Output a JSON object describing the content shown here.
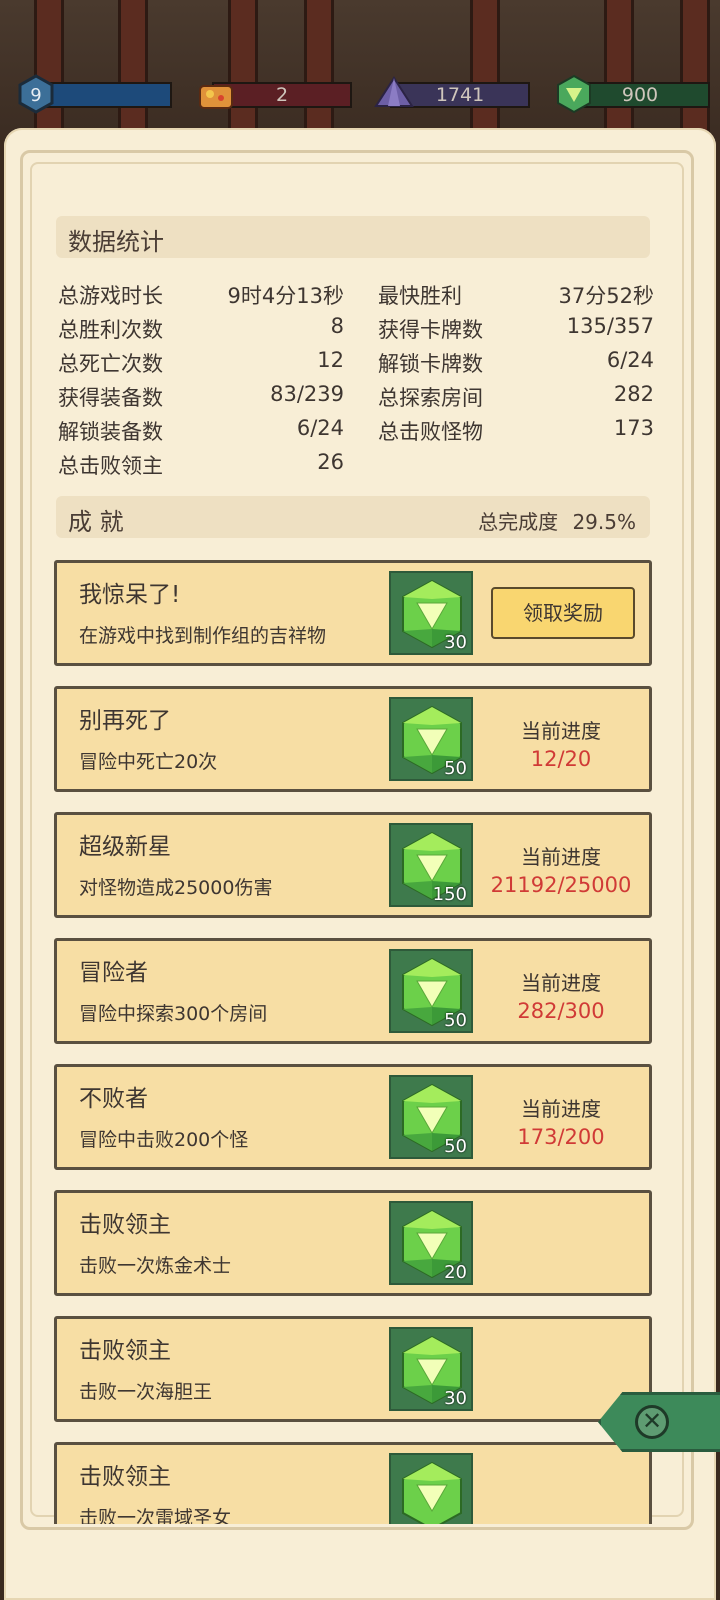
{
  "topbar": {
    "level": "9",
    "resources": [
      {
        "name": "chest",
        "value": "2",
        "color": "#5b1f24"
      },
      {
        "name": "crystal",
        "value": "1741",
        "color": "#3a3458"
      },
      {
        "name": "gem",
        "value": "900",
        "color": "#1f4a2e"
      }
    ]
  },
  "stats": {
    "title": "数据统计",
    "left": [
      {
        "label": "总游戏时长",
        "value": "9时4分13秒"
      },
      {
        "label": "总胜利次数",
        "value": "8"
      },
      {
        "label": "总死亡次数",
        "value": "12"
      },
      {
        "label": "获得装备数",
        "value": "83/239"
      },
      {
        "label": "解锁装备数",
        "value": "6/24"
      },
      {
        "label": "总击败领主",
        "value": "26"
      }
    ],
    "right": [
      {
        "label": "最快胜利",
        "value": "37分52秒"
      },
      {
        "label": "获得卡牌数",
        "value": "135/357"
      },
      {
        "label": "解锁卡牌数",
        "value": "6/24"
      },
      {
        "label": "总探索房间",
        "value": "282"
      },
      {
        "label": "总击败怪物",
        "value": "173"
      }
    ]
  },
  "achievements": {
    "title": "成 就",
    "completion_label": "总完成度",
    "completion_value": "29.5%",
    "progress_label": "当前进度",
    "claim_label": "领取奖励",
    "items": [
      {
        "title": "我惊呆了!",
        "desc": "在游戏中找到制作组的吉祥物",
        "reward": "30",
        "progress": "",
        "claimable": true
      },
      {
        "title": "别再死了",
        "desc": "冒险中死亡20次",
        "reward": "50",
        "progress": "12/20"
      },
      {
        "title": "超级新星",
        "desc": "对怪物造成25000伤害",
        "reward": "150",
        "progress": "21192/25000"
      },
      {
        "title": "冒险者",
        "desc": "冒险中探索300个房间",
        "reward": "50",
        "progress": "282/300"
      },
      {
        "title": "不败者",
        "desc": "冒险中击败200个怪",
        "reward": "50",
        "progress": "173/200"
      },
      {
        "title": "击败领主",
        "desc": "击败一次炼金术士",
        "reward": "20",
        "progress": ""
      },
      {
        "title": "击败领主",
        "desc": "击败一次海胆王",
        "reward": "30",
        "progress": ""
      },
      {
        "title": "击败领主",
        "desc": "击败一次雷域圣女",
        "reward": "",
        "progress": ""
      }
    ]
  },
  "colors": {
    "progress_text": "#d03a36",
    "card_bg": "#f7dea4",
    "gem_bg": "#3e7a4c"
  }
}
